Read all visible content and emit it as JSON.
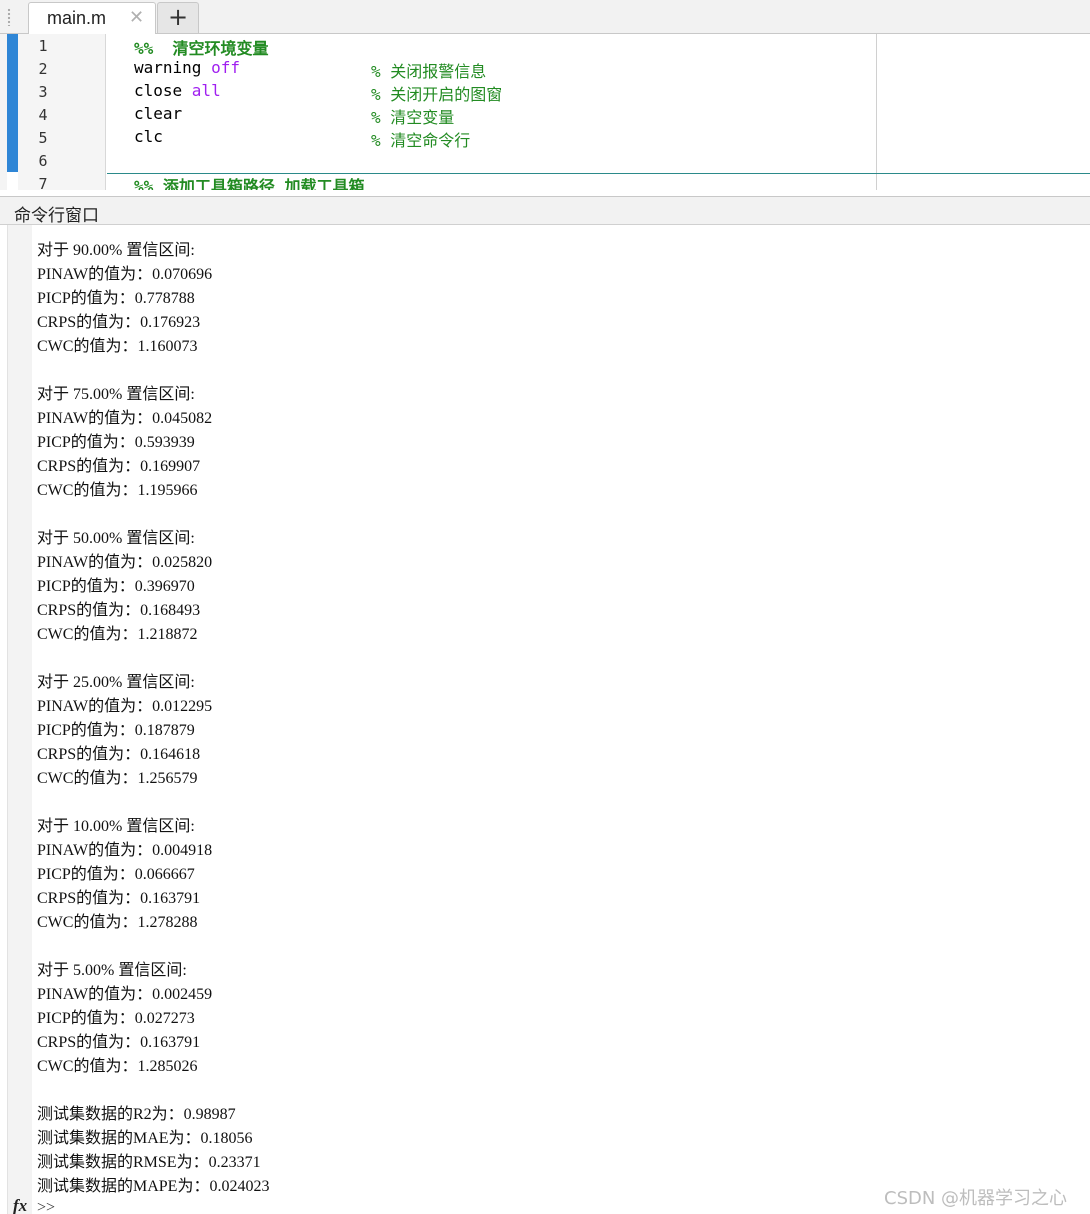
{
  "tabs": [
    {
      "label": "main.m",
      "close_glyph": "✕"
    }
  ],
  "add_tab_glyph": "+",
  "editor": {
    "lines": [
      {
        "num": "1",
        "title": "%%  清空环境变量"
      },
      {
        "num": "2",
        "code": "warning ",
        "kw": "off",
        "comment": "% 关闭报警信息"
      },
      {
        "num": "3",
        "code": "close ",
        "kw": "all",
        "comment": "% 关闭开启的图窗"
      },
      {
        "num": "4",
        "code": "clear",
        "comment": "% 清空变量"
      },
      {
        "num": "5",
        "code": "clc",
        "comment": "% 清空命令行"
      },
      {
        "num": "6"
      },
      {
        "num": "7",
        "title": "%% 添加工具箱路径 加载工具箱"
      }
    ]
  },
  "command_window": {
    "title": "命令行窗口",
    "blocks": [
      {
        "header": "对于 90.00% 置信区间:",
        "lines": [
          "PINAW的值为：0.070696",
          "PICP的值为：0.778788",
          "CRPS的值为：0.176923",
          "CWC的值为：1.160073"
        ]
      },
      {
        "header": "对于 75.00% 置信区间:",
        "lines": [
          "PINAW的值为：0.045082",
          "PICP的值为：0.593939",
          "CRPS的值为：0.169907",
          "CWC的值为：1.195966"
        ]
      },
      {
        "header": "对于 50.00% 置信区间:",
        "lines": [
          "PINAW的值为：0.025820",
          "PICP的值为：0.396970",
          "CRPS的值为：0.168493",
          "CWC的值为：1.218872"
        ]
      },
      {
        "header": "对于 25.00% 置信区间:",
        "lines": [
          "PINAW的值为：0.012295",
          "PICP的值为：0.187879",
          "CRPS的值为：0.164618",
          "CWC的值为：1.256579"
        ]
      },
      {
        "header": "对于 10.00% 置信区间:",
        "lines": [
          "PINAW的值为：0.004918",
          "PICP的值为：0.066667",
          "CRPS的值为：0.163791",
          "CWC的值为：1.278288"
        ]
      },
      {
        "header": "对于 5.00% 置信区间:",
        "lines": [
          "PINAW的值为：0.002459",
          "PICP的值为：0.027273",
          "CRPS的值为：0.163791",
          "CWC的值为：1.285026"
        ]
      }
    ],
    "summary": [
      "测试集数据的R2为：0.98987",
      "测试集数据的MAE为：0.18056",
      "测试集数据的RMSE为：0.23371",
      "测试集数据的MAPE为：0.024023"
    ],
    "fx_label": "fx",
    "prompt": ">>"
  },
  "watermark": "CSDN @机器学习之心",
  "colors": {
    "keyword": "#a020f0",
    "comment": "#228b22",
    "change_bar": "#2f86d6"
  }
}
